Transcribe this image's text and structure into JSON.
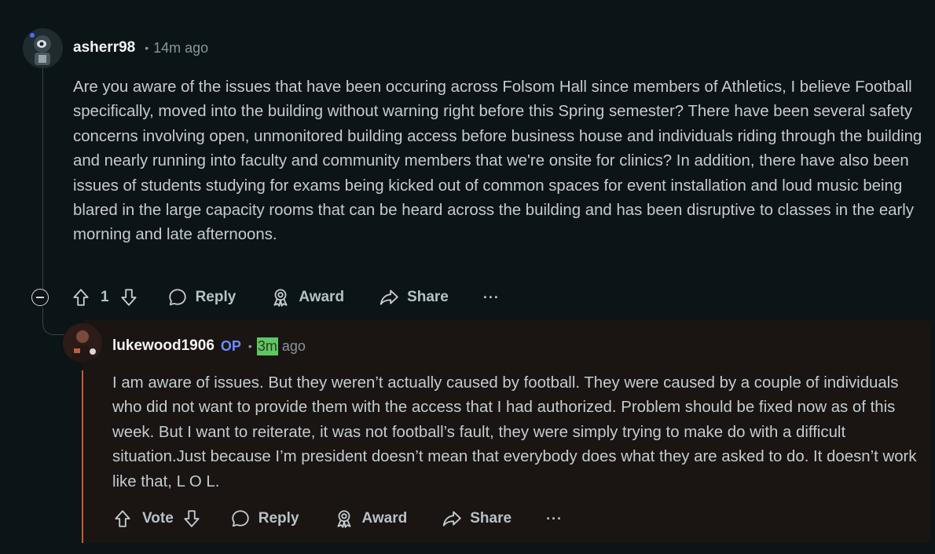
{
  "comment": {
    "username": "asherr98",
    "separator": "•",
    "time": "14m ago",
    "body": "Are you aware of the issues that have been occuring across Folsom Hall since members of Athletics, I believe Football specifically, moved into the building without warning right before this Spring semester? There have been several safety concerns involving open, unmonitored building access before business house and individuals riding through the building and nearly running into faculty and community members that we're onsite for clinics? In addition, there have also been issues of students studying for exams being kicked out of common spaces for event installation and loud music being blared in the large capacity rooms that can be heard across the building and has been disruptive to classes in the early morning and late afternoons.",
    "vote_count": "1",
    "actions": {
      "reply": "Reply",
      "award": "Award",
      "share": "Share",
      "more": "···"
    }
  },
  "reply": {
    "username": "lukewood1906",
    "op_tag": "OP",
    "separator": "•",
    "time_value": "3m",
    "time_suffix": "ago",
    "body": "I am aware of issues. But they weren’t actually caused by football. They were caused by a couple of individuals who did not want to provide them with the access that I had authorized. Problem should be fixed now as of this week. But I want to reiterate, it was not football’s fault, they were simply trying to make do with a difficult situation.Just because I’m president doesn’t mean that everybody does what they are asked to do. It doesn’t work like that, L O L.",
    "vote_label": "Vote",
    "actions": {
      "reply": "Reply",
      "award": "Award",
      "share": "Share",
      "more": "···"
    }
  },
  "colors": {
    "background": "#0b1416",
    "reply_background": "#1a1412",
    "op_accent": "#6a8bff",
    "highlight": "#5fc760",
    "reply_thread_accent": "#c75a32"
  },
  "icons": {
    "collapse": "minus-circle-icon",
    "upvote": "arrow-up-icon",
    "downvote": "arrow-down-icon",
    "reply": "speech-bubble-icon",
    "award": "award-ribbon-icon",
    "share": "share-arrow-icon"
  }
}
